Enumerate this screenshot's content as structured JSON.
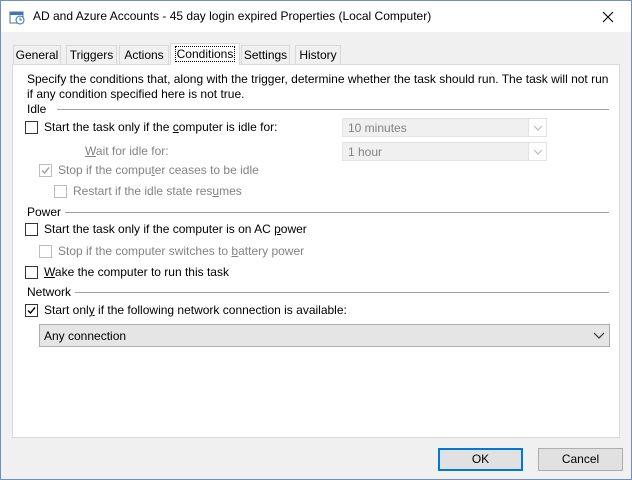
{
  "window": {
    "title": "AD and Azure Accounts - 45 day login expired Properties (Local Computer)"
  },
  "tabs": [
    {
      "label": "General"
    },
    {
      "label": "Triggers"
    },
    {
      "label": "Actions"
    },
    {
      "label": "Conditions"
    },
    {
      "label": "Settings"
    },
    {
      "label": "History"
    }
  ],
  "conditions": {
    "description": "Specify the conditions that, along with the trigger, determine whether the task should run.  The task will not run  if any condition specified here is not true.",
    "idle": {
      "group_label": "Idle",
      "start_if_idle": {
        "pre": "Start the task only if the ",
        "mn": "c",
        "post": "omputer is idle for:",
        "checked": false
      },
      "idle_for_value": "10 minutes",
      "wait_label": {
        "mn": "W",
        "post": "ait for idle for:"
      },
      "wait_value": "1 hour",
      "stop_if_ceases": {
        "pre": "Stop if the compu",
        "mn": "t",
        "post": "er ceases to be idle",
        "checked": true
      },
      "restart_if_resumes": {
        "pre": "Restart if the idle state res",
        "mn": "u",
        "post": "mes",
        "checked": false
      }
    },
    "power": {
      "group_label": "Power",
      "start_if_ac": {
        "pre": "Start the task only if the computer is on AC ",
        "mn": "p",
        "post": "ower",
        "checked": false
      },
      "stop_if_battery": {
        "pre": "Stop if the computer switches to ",
        "mn": "b",
        "post": "attery power",
        "checked": false
      },
      "wake": {
        "pre": "",
        "mn": "W",
        "post": "ake the computer to run this task",
        "checked": false
      }
    },
    "network": {
      "group_label": "Network",
      "start_if_network": {
        "pre": "Start onl",
        "mn": "y",
        "post": " if the following network connection is available:",
        "checked": true
      },
      "connection_value": "Any connection"
    }
  },
  "buttons": {
    "ok": "OK",
    "cancel": "Cancel"
  }
}
